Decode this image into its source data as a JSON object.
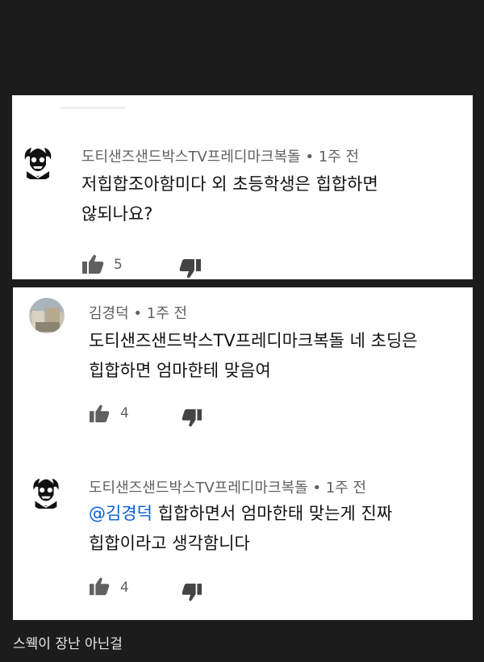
{
  "comments": [
    {
      "author": "도티샌즈샌드박스TV프레디마크복돌",
      "time": "1주 전",
      "text_line1": "저힙합조아함미다 외 초등학생은 힙합하면",
      "text_line2": "않되나요?",
      "likes": "5",
      "avatar_icon": "skull-dragon-avatar"
    },
    {
      "author": "김경덕",
      "time": "1주 전",
      "text_line1": "도티샌즈샌드박스TV프레디마크복돌 네 초딩은",
      "text_line2": "힙합하면 엄마한테 맞음여",
      "likes": "4",
      "avatar_icon": "photo-avatar"
    },
    {
      "author": "도티샌즈샌드박스TV프레디마크복돌",
      "time": "1주 전",
      "mention": "@김경덕",
      "text_line1_rest": " 힙합하면서 엄마한태 맞는게 진짜",
      "text_line2": "힙합이라고 생각함니다",
      "likes": "4",
      "avatar_icon": "skull-dragon-avatar"
    }
  ],
  "meta_separator": "•",
  "caption": "스웩이 장난 아닌걸",
  "colors": {
    "background": "#1c1c1c",
    "card": "#ffffff",
    "mention": "#065fd4",
    "meta": "#606060"
  }
}
